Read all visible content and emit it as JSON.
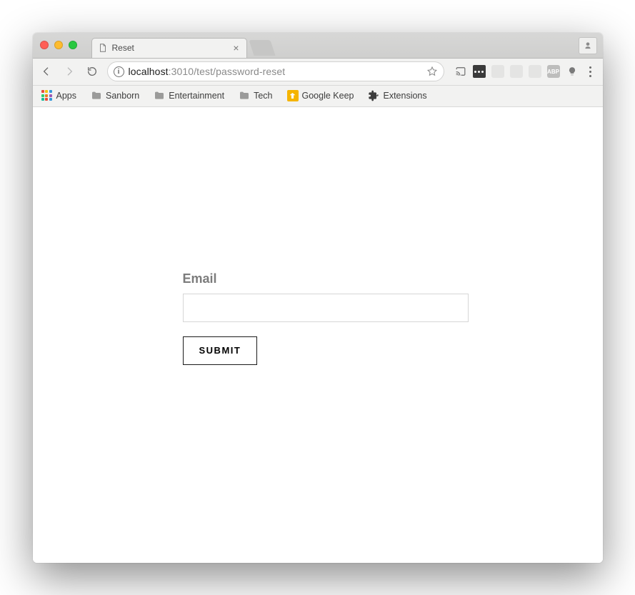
{
  "browser": {
    "tab": {
      "title": "Reset"
    },
    "url": {
      "host_main": "localhost",
      "host_rest_and_path": ":3010/test/password-reset"
    },
    "bookmarks": {
      "apps": "Apps",
      "items": [
        {
          "label": "Sanborn",
          "type": "folder"
        },
        {
          "label": "Entertainment",
          "type": "folder"
        },
        {
          "label": "Tech",
          "type": "folder"
        },
        {
          "label": "Google Keep",
          "type": "keep"
        },
        {
          "label": "Extensions",
          "type": "ext"
        }
      ]
    }
  },
  "page": {
    "form": {
      "email_label": "Email",
      "email_value": "",
      "submit_label": "SUBMIT"
    }
  }
}
